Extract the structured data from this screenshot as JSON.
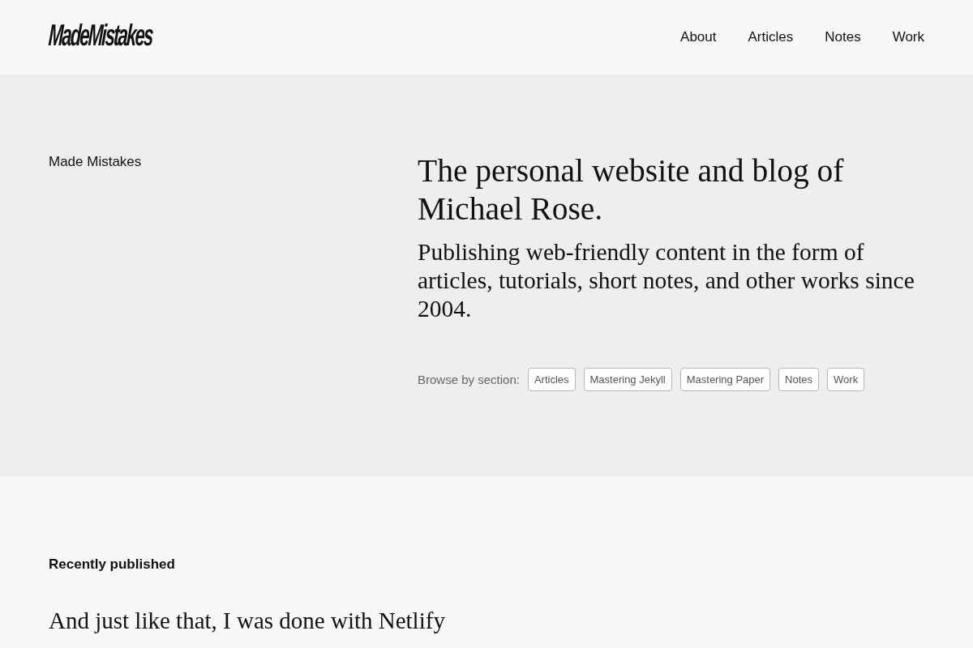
{
  "header": {
    "logo": "MadeMistakes",
    "nav": [
      "About",
      "Articles",
      "Notes",
      "Work"
    ]
  },
  "hero": {
    "site_name": "Made Mistakes",
    "title": "The personal website and blog of Michael Rose.",
    "description": "Publishing web-friendly content in the form of articles, tutorials, short notes, and other works since 2004.",
    "browse": {
      "label": "Browse by section:",
      "sections": [
        "Articles",
        "Mastering Jekyll",
        "Mastering Paper",
        "Notes",
        "Work"
      ]
    }
  },
  "recent": {
    "heading": "Recently published",
    "posts": [
      {
        "title": "And just like that, I was done with Netlify"
      }
    ]
  }
}
